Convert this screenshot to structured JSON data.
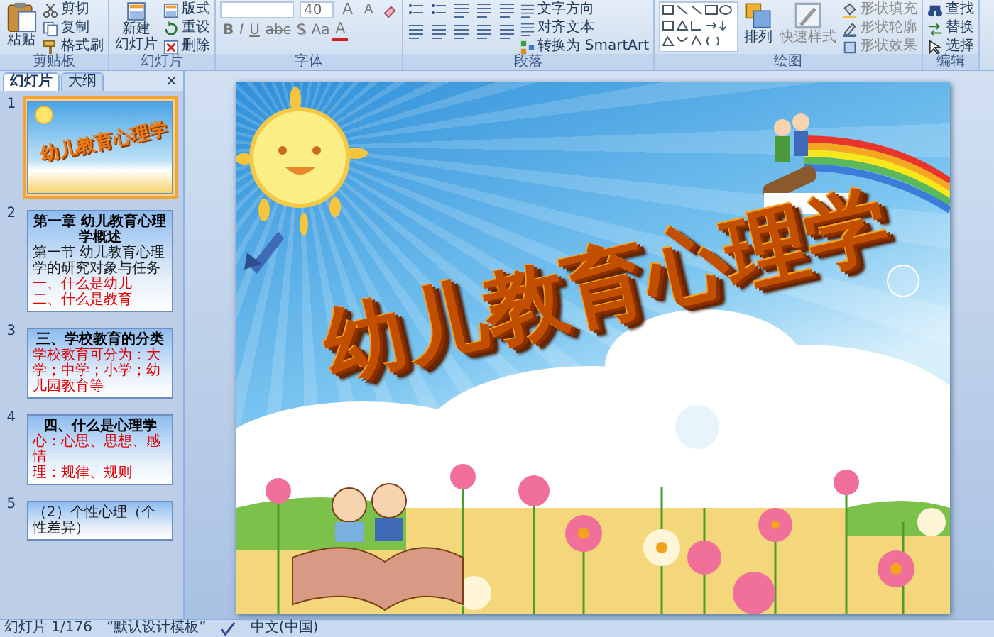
{
  "ribbon": {
    "groups": [
      {
        "kind": "clipboard",
        "label": "剪贴板",
        "large": "粘贴",
        "small": [
          "剪切",
          "复制",
          "格式刷"
        ]
      },
      {
        "kind": "slides",
        "label": "幻灯片",
        "large": [
          "新建",
          "幻灯片"
        ],
        "small": [
          "版式",
          "重设",
          "删除"
        ]
      },
      {
        "kind": "font",
        "label": "字体",
        "font_size": "40",
        "size_buttons": [
          "A",
          "A"
        ],
        "format_buttons": [
          "B",
          "I",
          "U",
          "abc",
          "S",
          "Aa",
          "A"
        ]
      },
      {
        "kind": "paragraph",
        "label": "段落",
        "small": [
          "文字方向",
          "对齐文本",
          "转换为 SmartArt"
        ]
      },
      {
        "kind": "drawing",
        "label": "绘图",
        "large": "排列",
        "large_2": "快速样式",
        "small": [
          "形状填充",
          "形状轮廓",
          "形状效果"
        ]
      },
      {
        "kind": "editing",
        "label": "编辑",
        "small": [
          "查找",
          "替换",
          "选择"
        ]
      }
    ]
  },
  "panel_tabs": [
    {
      "label": "幻灯片",
      "selected": true
    },
    {
      "label": "大纲",
      "selected": false
    }
  ],
  "panel_close": "×",
  "thumbnails": [
    {
      "number": "1",
      "kind": "title",
      "selected": true,
      "title": "幼儿教育心理学"
    },
    {
      "number": "2",
      "kind": "text",
      "selected": false,
      "title": "第一章 幼儿教育心理学概述",
      "lines": [
        {
          "text": "第一节 幼儿教育心理学的研究对象与任务",
          "color": "#1a1a1a"
        },
        {
          "text": "一、什么是幼儿",
          "color": "#e00000"
        },
        {
          "text": "二、什么是教育",
          "color": "#e00000"
        }
      ]
    },
    {
      "number": "3",
      "kind": "text",
      "selected": false,
      "title": "三、学校教育的分类",
      "lines": [
        {
          "text": "学校教育可分为：大学；中学；小学；幼儿园教育等",
          "color": "#e00000"
        }
      ]
    },
    {
      "number": "4",
      "kind": "text",
      "selected": false,
      "title": "四、什么是心理学",
      "lines": [
        {
          "text": "心：心思、思想、感情",
          "color": "#e00000"
        },
        {
          "text": "理：规律、规则",
          "color": "#e00000"
        }
      ]
    },
    {
      "number": "5",
      "kind": "text",
      "selected": false,
      "lines": [
        {
          "text": "（2）个性心理（个性差异）",
          "color": "#1a1a1a"
        }
      ]
    }
  ],
  "slide": {
    "title": "幼儿教育心理学"
  },
  "status_bar": {
    "slide_count": "幻灯片 1/176",
    "theme": "“默认设计模板”",
    "language": "中文(中国)"
  }
}
